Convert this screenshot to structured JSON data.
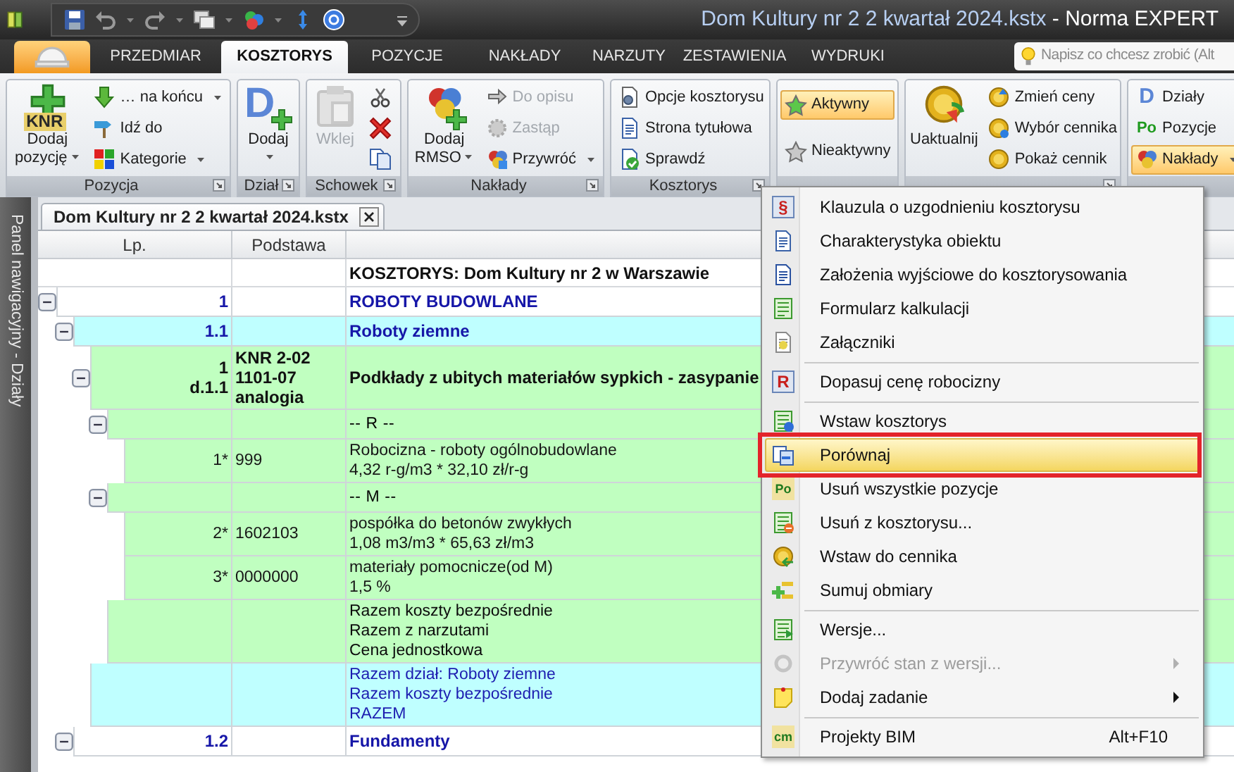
{
  "window": {
    "title": "Dom Kultury nr 2 2 kwartał 2024.kstx",
    "app_name": "- Norma EXPERT"
  },
  "ribbon_tabs": [
    {
      "label": "PRZEDMIAR",
      "selected": false
    },
    {
      "label": "KOSZTORYS",
      "selected": true
    },
    {
      "label": "POZYCJE",
      "selected": false
    },
    {
      "label": "NAKŁADY",
      "selected": false
    },
    {
      "label": "NARZUTY",
      "selected": false
    },
    {
      "label": "ZESTAWIENIA",
      "selected": false
    },
    {
      "label": "WYDRUKI",
      "selected": false
    }
  ],
  "search": {
    "placeholder": "Napisz co chcesz zrobić (Alt"
  },
  "ribbon_groups": [
    {
      "label": "Pozycja",
      "launcher": true,
      "items": [
        {
          "kind": "large",
          "label": "Dodaj pozycję",
          "icon_text": "KNR",
          "dropdown": true,
          "disabled": false
        },
        {
          "kind": "small",
          "label": "… na końcu",
          "dropdown": true,
          "disabled": false
        },
        {
          "kind": "small",
          "label": "Idź do",
          "dropdown": false,
          "disabled": false
        },
        {
          "kind": "small",
          "label": "Kategorie",
          "dropdown": true,
          "disabled": false
        }
      ]
    },
    {
      "label": "Dział",
      "launcher": true,
      "items": [
        {
          "kind": "large",
          "label": "Dodaj",
          "icon_text": "D",
          "dropdown": true,
          "disabled": false
        }
      ]
    },
    {
      "label": "Schowek",
      "launcher": true,
      "items": [
        {
          "kind": "large",
          "label": "Wklej",
          "dropdown": false,
          "disabled": true
        },
        {
          "kind": "icon",
          "dropdown": false,
          "disabled": false
        },
        {
          "kind": "icon",
          "dropdown": false,
          "disabled": false
        },
        {
          "kind": "icon",
          "dropdown": false,
          "disabled": false
        }
      ]
    },
    {
      "label": "Nakłady",
      "launcher": true,
      "items": [
        {
          "kind": "large",
          "label": "Dodaj RMSO",
          "dropdown": true,
          "disabled": false
        },
        {
          "kind": "small",
          "label": "Do opisu",
          "dropdown": false,
          "disabled": true
        },
        {
          "kind": "small",
          "label": "Zastąp",
          "dropdown": false,
          "disabled": true
        },
        {
          "kind": "small",
          "label": "Przywróć",
          "dropdown": true,
          "disabled": false
        }
      ]
    },
    {
      "label": "Kosztorys",
      "launcher": true,
      "items": [
        {
          "kind": "small",
          "label": "Opcje kosztorysu",
          "dropdown": false,
          "disabled": false
        },
        {
          "kind": "small",
          "label": "Strona tytułowa",
          "dropdown": false,
          "disabled": false
        },
        {
          "kind": "small",
          "label": "Sprawdź",
          "dropdown": false,
          "disabled": false
        }
      ]
    },
    {
      "launcher": false,
      "items": [
        {
          "kind": "small",
          "label": "Aktywny",
          "dropdown": false,
          "disabled": false,
          "selected": true
        },
        {
          "kind": "small",
          "label": "Nieaktywny",
          "dropdown": false,
          "disabled": false,
          "selected": false
        }
      ]
    },
    {
      "launcher": true,
      "items": [
        {
          "kind": "large",
          "label": "Uaktualnij",
          "dropdown": false,
          "disabled": false
        },
        {
          "kind": "small",
          "label": "Zmień ceny",
          "dropdown": false,
          "disabled": false
        },
        {
          "kind": "small",
          "label": "Wybór cennika",
          "dropdown": false,
          "disabled": false
        },
        {
          "kind": "small",
          "label": "Pokaż cennik",
          "dropdown": false,
          "disabled": false
        }
      ]
    },
    {
      "launcher": false,
      "items": [
        {
          "kind": "small",
          "label": "Działy",
          "icon_text": "D",
          "dropdown": false,
          "disabled": false,
          "selected": false
        },
        {
          "kind": "small",
          "label": "Pozycje",
          "icon_text": "Po",
          "dropdown": false,
          "disabled": false,
          "selected": false
        },
        {
          "kind": "small",
          "label": "Nakłady",
          "dropdown": true,
          "disabled": false,
          "selected": true
        }
      ]
    }
  ],
  "side_panel": {
    "title": "Panel nawigacyjny - Działy"
  },
  "document_tab": {
    "title": "Dom Kultury nr 2 2 kwartał 2024.kstx"
  },
  "table": {
    "columns": [
      "Lp.",
      "Podstawa"
    ],
    "title_row": "KOSZTORYS: Dom Kultury nr 2 w Warszawie",
    "rows": [
      {
        "kind": "section",
        "lp": "1",
        "description": "ROBOTY BUDOWLANE",
        "expanded": true,
        "selected": false,
        "children": [
          {
            "kind": "section",
            "lp": "1.1",
            "description": "Roboty ziemne",
            "expanded": true,
            "selected": true,
            "children": [
              {
                "kind": "position",
                "lp": "1\nd.1.1",
                "basis": "KNR 2-02\n1101-07\nanalogia",
                "description": "Podkłady z ubitych materiałów sypkich - zasypanie",
                "expanded": true,
                "selected": false,
                "children": [
                  {
                    "kind": "group",
                    "description": "-- R --",
                    "expanded": true,
                    "selected": false,
                    "children": [
                      {
                        "kind": "resource",
                        "lp": "1*",
                        "basis": "999",
                        "description": "Robocizna - roboty ogólnobudowlane\n4,32 r-g/m3 * 32,10 zł/r-g",
                        "selected": false
                      }
                    ]
                  },
                  {
                    "kind": "group",
                    "description": "-- M --",
                    "expanded": true,
                    "selected": false,
                    "children": [
                      {
                        "kind": "resource",
                        "lp": "2*",
                        "basis": "1602103",
                        "description": "pospółka do betonów zwykłych\n1,08 m3/m3 * 65,63 zł/m3",
                        "selected": false
                      },
                      {
                        "kind": "resource",
                        "lp": "3*",
                        "basis": "0000000",
                        "description": "materiały pomocnicze(od M)\n1,5 %",
                        "selected": false
                      }
                    ]
                  },
                  {
                    "kind": "summary",
                    "description": "Razem koszty bezpośrednie\nRazem z narzutami\nCena jednostkowa",
                    "selected": false
                  }
                ]
              },
              {
                "kind": "section_summary",
                "description": "Razem dział: Roboty ziemne\nRazem koszty bezpośrednie\nRAZEM",
                "selected": true
              }
            ]
          },
          {
            "kind": "section",
            "lp": "1.2",
            "description": "Fundamenty",
            "expanded": true,
            "selected": false
          }
        ]
      }
    ]
  },
  "context_menu": {
    "items": [
      {
        "label": "Klauzula o uzgodnieniu kosztorysu",
        "icon_text": "§",
        "separator_before": false,
        "selected": false,
        "annotated": false,
        "disabled": false,
        "submenu": false
      },
      {
        "label": "Charakterystyka obiektu",
        "separator_before": false,
        "selected": false,
        "annotated": false,
        "disabled": false,
        "submenu": false
      },
      {
        "label": "Założenia wyjściowe do kosztorysowania",
        "separator_before": false,
        "selected": false,
        "annotated": false,
        "disabled": false,
        "submenu": false
      },
      {
        "label": "Formularz kalkulacji",
        "separator_before": false,
        "selected": false,
        "annotated": false,
        "disabled": false,
        "submenu": false
      },
      {
        "label": "Załączniki",
        "separator_before": false,
        "selected": false,
        "annotated": false,
        "disabled": false,
        "submenu": false
      },
      {
        "label": "Dopasuj cenę robocizny",
        "icon_text": "R",
        "separator_before": true,
        "selected": false,
        "annotated": false,
        "disabled": false,
        "submenu": false
      },
      {
        "label": "Wstaw kosztorys",
        "separator_before": true,
        "selected": false,
        "annotated": false,
        "disabled": false,
        "submenu": false
      },
      {
        "label": "Porównaj",
        "separator_before": false,
        "selected": true,
        "annotated": true,
        "disabled": false,
        "submenu": false
      },
      {
        "label": "Usuń wszystkie pozycje",
        "icon_text": "Po",
        "separator_before": false,
        "selected": false,
        "annotated": false,
        "disabled": false,
        "submenu": false
      },
      {
        "label": "Usuń z kosztorysu...",
        "separator_before": false,
        "selected": false,
        "annotated": false,
        "disabled": false,
        "submenu": false
      },
      {
        "label": "Wstaw do cennika",
        "separator_before": false,
        "selected": false,
        "annotated": false,
        "disabled": false,
        "submenu": false
      },
      {
        "label": "Sumuj obmiary",
        "separator_before": false,
        "selected": false,
        "annotated": false,
        "disabled": false,
        "submenu": false
      },
      {
        "label": "Wersje...",
        "separator_before": true,
        "selected": false,
        "annotated": false,
        "disabled": false,
        "submenu": false
      },
      {
        "label": "Przywróć stan z wersji...",
        "separator_before": false,
        "selected": false,
        "annotated": false,
        "disabled": true,
        "submenu": true
      },
      {
        "label": "Dodaj zadanie",
        "separator_before": false,
        "selected": false,
        "annotated": false,
        "disabled": false,
        "submenu": true
      },
      {
        "label": "Projekty BIM",
        "icon_text": "cm",
        "shortcut": "Alt+F10",
        "separator_before": true,
        "selected": false,
        "annotated": false,
        "disabled": false,
        "submenu": false
      }
    ]
  }
}
